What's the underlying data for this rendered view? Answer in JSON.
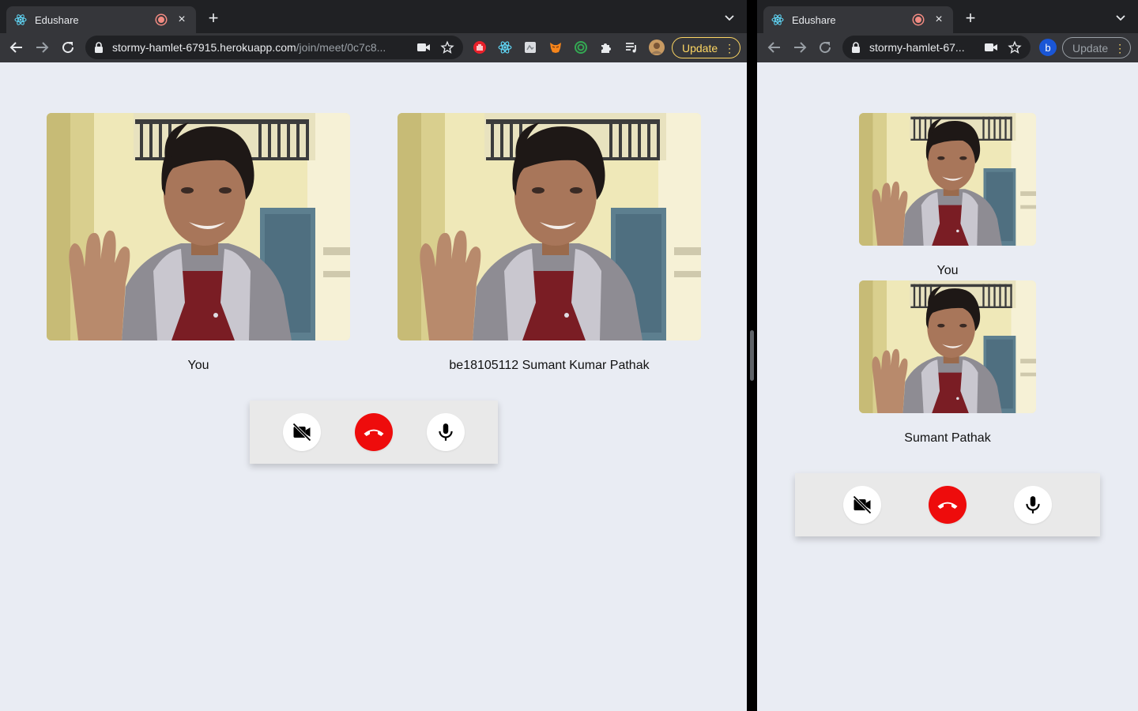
{
  "left_window": {
    "tab": {
      "title": "Edushare",
      "favicon": "react-icon",
      "recording_indicator": "record-icon",
      "close": "×"
    },
    "new_tab": "+",
    "url": {
      "host": "stormy-hamlet-67915.herokuapp.com",
      "path": "/join/meet/0c7c8..."
    },
    "update_button": "Update",
    "extensions": [
      "red-hand-extension-icon",
      "react-devtools-icon",
      "gray-extension-icon",
      "metamask-fox-icon",
      "green-ring-extension-icon",
      "puzzle-extensions-icon",
      "media-queue-icon",
      "profile-avatar"
    ],
    "participants": [
      {
        "label": "You"
      },
      {
        "label": "be18105112 Sumant Kumar Pathak"
      }
    ]
  },
  "right_window": {
    "tab": {
      "title": "Edushare",
      "favicon": "react-icon",
      "recording_indicator": "record-icon",
      "close": "×"
    },
    "new_tab": "+",
    "url": {
      "host": "stormy-hamlet-67..."
    },
    "profile_initial": "b",
    "update_button": "Update",
    "participants": [
      {
        "label": "You"
      },
      {
        "label": "Sumant Pathak"
      }
    ]
  },
  "controls": {
    "camera": "camera-off-icon",
    "hangup": "hang-up-icon",
    "mic": "microphone-icon"
  },
  "colors": {
    "page_bg": "#e9ecf3",
    "hangup_red": "#ee0c0c",
    "update_yellow": "#fdd663",
    "tabstrip": "#202124",
    "toolbar": "#35363a"
  }
}
